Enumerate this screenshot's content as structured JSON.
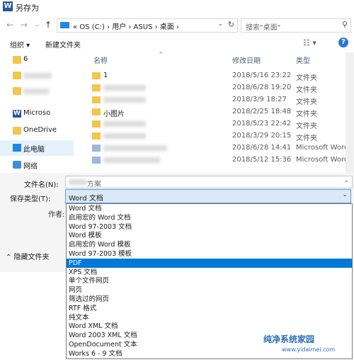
{
  "window": {
    "title": "另存为",
    "app_icon": "W"
  },
  "nav": {
    "back": "←",
    "forward": "→",
    "recent": "⌄",
    "up": "↑"
  },
  "address": {
    "segments": "« OS (C:) › 用户 › ASUS › 桌面 ›",
    "chevron": "⌄",
    "refresh": "↻"
  },
  "search": {
    "placeholder": "搜索\"桌面\"",
    "icon": "search-icon"
  },
  "toolbar": {
    "organize": "组织 ▾",
    "new_folder": "新建文件夹",
    "view": "☷ ▾",
    "help": "?"
  },
  "navpane": {
    "items": [
      {
        "label": "6",
        "icon": "folder-icon"
      },
      {
        "label": "",
        "icon": "folder-icon"
      },
      {
        "label": "",
        "icon": "folder-icon"
      },
      {
        "label": "Microso",
        "icon": "word-icon"
      },
      {
        "label": "OneDrive",
        "icon": "folder-icon"
      },
      {
        "label": "此电脑",
        "icon": "computer-icon"
      },
      {
        "label": "网络",
        "icon": "network-icon"
      }
    ]
  },
  "filelist": {
    "headers": {
      "name": "名称",
      "date": "修改日期",
      "type": "类型"
    },
    "rows": [
      {
        "name": "1",
        "date": "2018/5/16 23:22",
        "type": "文件夹",
        "kind": "folder"
      },
      {
        "name": "",
        "date": "2018/6/28 19:20",
        "type": "文件夹",
        "kind": "folder"
      },
      {
        "name": "",
        "date": "2018/3/9 18:27",
        "type": "文件夹",
        "kind": "folder"
      },
      {
        "name": "小图片",
        "date": "2018/2/25 18:48",
        "type": "文件夹",
        "kind": "folder"
      },
      {
        "name": "",
        "date": "2018/5/23 22:42",
        "type": "文件夹",
        "kind": "folder"
      },
      {
        "name": "",
        "date": "2018/3/29 20:15",
        "type": "文件夹",
        "kind": "folder"
      },
      {
        "name": "",
        "date": "2018/6/28 14:41",
        "type": "Microsoft Word",
        "kind": "doc"
      },
      {
        "name": "",
        "date": "2018/5/12 15:36",
        "type": "Microsoft Word",
        "kind": "doc"
      }
    ]
  },
  "form": {
    "filename_label": "文件名(N):",
    "filename_value": "方案",
    "filetype_label": "保存类型(T):",
    "filetype_value": "Word 文档",
    "author_label": "作者:",
    "hide_folders": "⌃ 隐藏文件夹"
  },
  "dropdown": {
    "options": [
      "Word 文档",
      "启用宏的 Word 文档",
      "Word 97-2003 文档",
      "Word 模板",
      "启用宏的 Word 模板",
      "Word 97-2003 模板",
      "PDF",
      "XPS 文档",
      "单个文件网页",
      "网页",
      "筛选过的网页",
      "RTF 格式",
      "纯文本",
      "Word XML 文档",
      "Word 2003 XML 文档",
      "OpenDocument 文本",
      "Works 6 - 9 文档"
    ],
    "highlighted_index": 6
  },
  "watermark": {
    "text": "纯净系统家园",
    "url": "www.yidaimei.com"
  },
  "colors": {
    "accent": "#0078d7",
    "select_bg": "#dbe9f7",
    "folder": "#f3c64c"
  }
}
